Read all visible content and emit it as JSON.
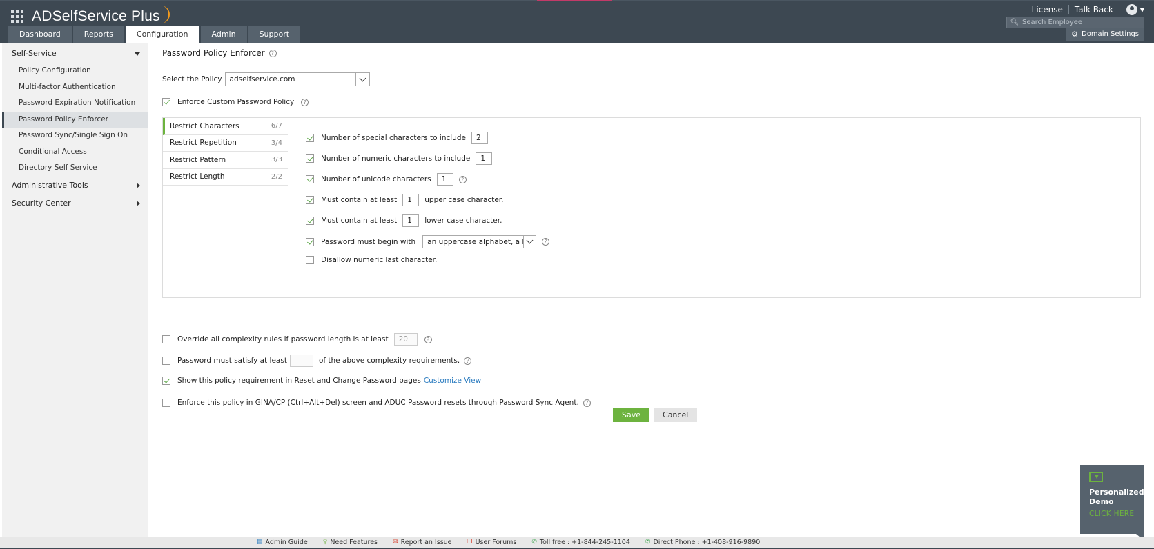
{
  "app": {
    "title": "ADSelfService Plus"
  },
  "header": {
    "links": [
      "License",
      "Talk Back"
    ],
    "search_placeholder": "Search Employee",
    "domain_settings": "Domain Settings",
    "tabs": [
      "Dashboard",
      "Reports",
      "Configuration",
      "Admin",
      "Support"
    ],
    "active_tab": "Configuration"
  },
  "sidebar": {
    "self_service": "Self-Service",
    "items": [
      "Policy Configuration",
      "Multi-factor Authentication",
      "Password Expiration Notification",
      "Password Policy Enforcer",
      "Password Sync/Single Sign On",
      "Conditional Access",
      "Directory Self Service"
    ],
    "active_item": "Password Policy Enforcer",
    "administrative_tools": "Administrative Tools",
    "security_center": "Security Center"
  },
  "main": {
    "title": "Password Policy Enforcer",
    "select_policy_label": "Select the Policy",
    "selected_policy": "adselfservice.com",
    "enforce_custom_label": "Enforce Custom Password Policy",
    "enforce_custom_checked": true,
    "panel_tabs": [
      {
        "label": "Restrict Characters",
        "count": "6/7"
      },
      {
        "label": "Restrict Repetition",
        "count": "3/4"
      },
      {
        "label": "Restrict Pattern",
        "count": "3/3"
      },
      {
        "label": "Restrict Length",
        "count": "2/2"
      }
    ],
    "rules": {
      "special": {
        "label": "Number of special characters to include",
        "value": "2",
        "checked": true
      },
      "numeric": {
        "label": "Number of numeric characters to include",
        "value": "1",
        "checked": true
      },
      "unicode": {
        "label": "Number of unicode characters",
        "value": "1",
        "checked": true
      },
      "upper": {
        "label": "Must contain at least",
        "value": "1",
        "suffix": "upper case character.",
        "checked": true
      },
      "lower": {
        "label": "Must contain at least",
        "value": "1",
        "suffix": "lower case character.",
        "checked": true
      },
      "begin": {
        "label": "Password must begin with",
        "value": "an uppercase alphabet, a lowe",
        "checked": true
      },
      "disallow": {
        "label": "Disallow numeric last character.",
        "checked": false
      }
    },
    "override": {
      "label": "Override all complexity rules if password length is at least",
      "value": "20",
      "checked": false
    },
    "satisfy": {
      "label": "Password must satisfy at least",
      "value": "",
      "suffix": "of the above complexity requirements.",
      "checked": false
    },
    "show_policy": {
      "label": "Show this policy requirement in Reset and Change Password pages",
      "link": "Customize View",
      "checked": true
    },
    "enforce_gina": {
      "label": "Enforce this policy in GINA/CP (Ctrl+Alt+Del) screen and ADUC Password resets through Password Sync Agent.",
      "checked": false
    },
    "save_label": "Save",
    "cancel_label": "Cancel"
  },
  "demo": {
    "line1": "Personalized",
    "line2": "Demo",
    "cta": "CLICK HERE"
  },
  "footer": {
    "admin_guide": "Admin Guide",
    "need_features": "Need Features",
    "report_issue": "Report an Issue",
    "user_forums": "User Forums",
    "toll_free": "Toll free : +1-844-245-1104",
    "direct_phone": "Direct Phone : +1-408-916-9890"
  },
  "colors": {
    "header_bg": "#3d4852",
    "accent_green": "#6db33f",
    "link_blue": "#2a7bbf"
  }
}
